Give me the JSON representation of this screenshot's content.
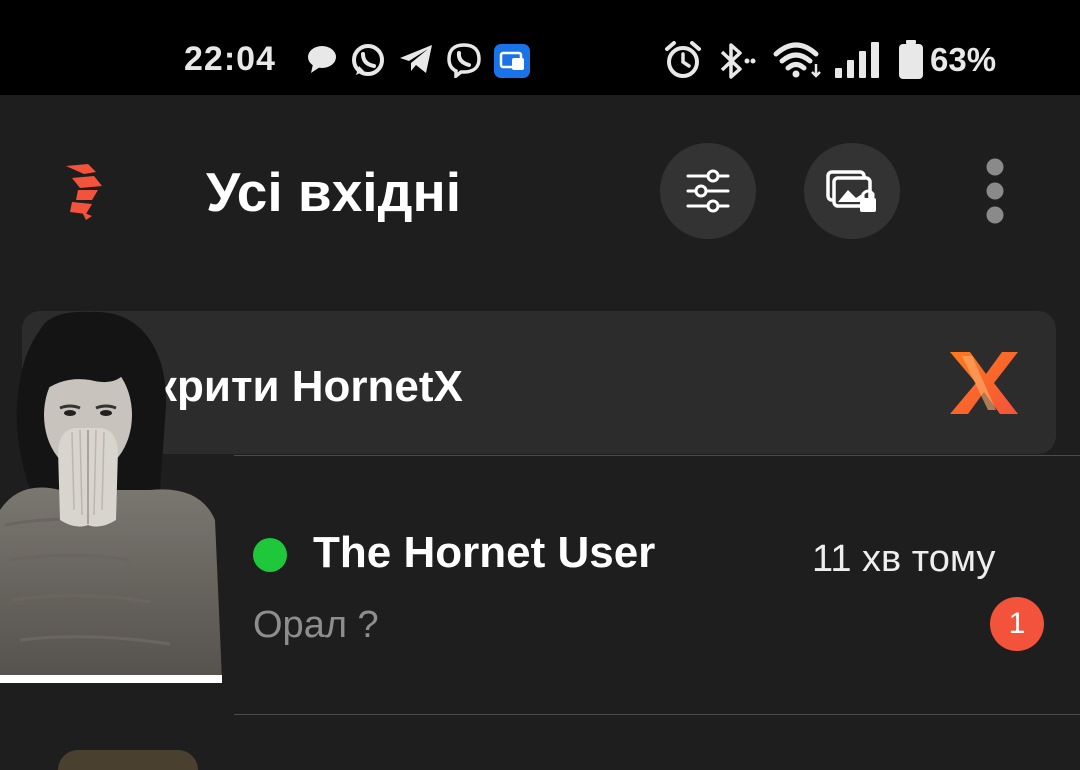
{
  "status_bar": {
    "time": "22:04",
    "notification_icons": [
      "messages-icon",
      "whatsapp-icon",
      "telegram-icon",
      "viber-icon",
      "cast-icon"
    ],
    "system_icons": [
      "alarm-icon",
      "bluetooth-icon",
      "wifi-icon",
      "signal-icon",
      "battery-icon"
    ],
    "battery_percent": "63%"
  },
  "app_bar": {
    "logo": "hornet-logo",
    "title": "Усі вхідні",
    "actions": [
      "filter-sliders-icon",
      "private-photos-lock-icon",
      "more-vert-icon"
    ]
  },
  "promo_banner": {
    "text": "крити HornetX",
    "logo": "hornetx-logo"
  },
  "chats": [
    {
      "name": "The Hornet User",
      "time_ago": "11 хв тому",
      "message": "Орал ?",
      "unread": "1",
      "online": true
    }
  ],
  "colors": {
    "background": "#1e1e1e",
    "brand_orange": "#f4533b",
    "online_green": "#1fc83a"
  }
}
